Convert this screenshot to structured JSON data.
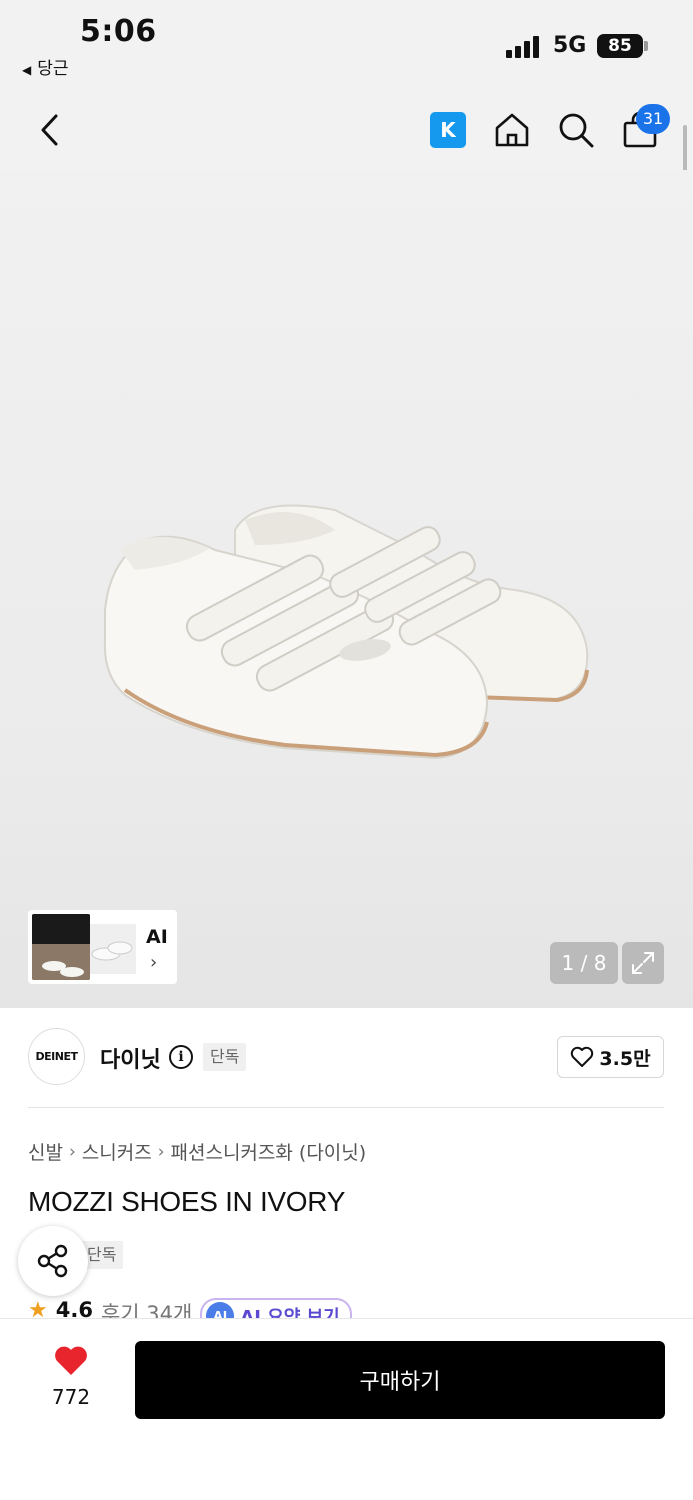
{
  "status_bar": {
    "time": "5:06",
    "back_app": "당근",
    "network": "5G",
    "battery": "85"
  },
  "nav": {
    "k_label": "K",
    "cart_count": "31"
  },
  "gallery": {
    "ai_label": "AI",
    "pager": "1 / 8"
  },
  "brand": {
    "logo_text": "DEINET",
    "name": "다이닛",
    "exclusive_tag": "단독",
    "likes": "3.5만"
  },
  "product": {
    "breadcrumb": [
      "신발",
      "스니커즈",
      "패션스니커즈화 (다이닛)"
    ],
    "title": "MOZZI SHOES IN IVORY",
    "exclusive_tag": "단독",
    "rating": "4.6",
    "reviews": "후기 34개",
    "ai_badge": "AI",
    "ai_summary": "AI 요약 보기"
  },
  "bottom_bar": {
    "wish_count": "772",
    "buy_label": "구매하기"
  },
  "colors": {
    "accent_blue": "#1a73e8",
    "kakao_blue": "#1499ef",
    "heart_red": "#e8242d",
    "buy_black": "#000000"
  }
}
